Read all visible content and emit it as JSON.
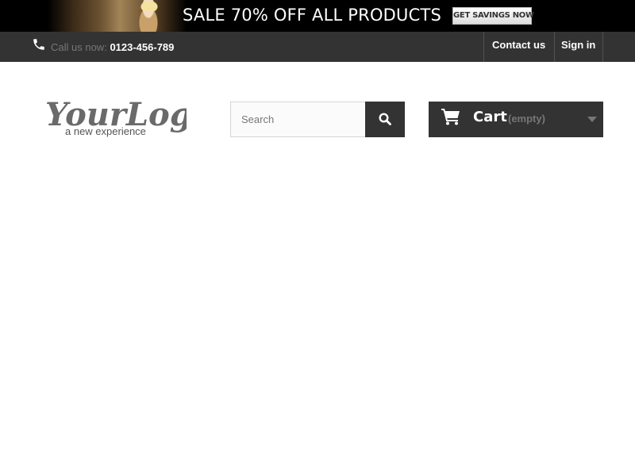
{
  "banner": {
    "headline": "SALE 70% OFF ALL PRODUCTS",
    "cta_label": "GET SAVINGS NOW"
  },
  "nav": {
    "call_label": "Call us now:",
    "phone": "0123-456-789",
    "contact_label": "Contact us",
    "signin_label": "Sign in"
  },
  "logo": {
    "text": "YourLogo",
    "tagline": "a new experience"
  },
  "search": {
    "placeholder": "Search",
    "value": ""
  },
  "cart": {
    "label": "Cart",
    "status": "(empty)"
  },
  "icons": {
    "phone": "phone-icon",
    "search": "search-icon",
    "cart": "shopping-cart-icon",
    "dropdown": "caret-down-icon"
  },
  "colors": {
    "dark": "#333333",
    "muted": "#777777",
    "banner_bg": "#000000"
  }
}
